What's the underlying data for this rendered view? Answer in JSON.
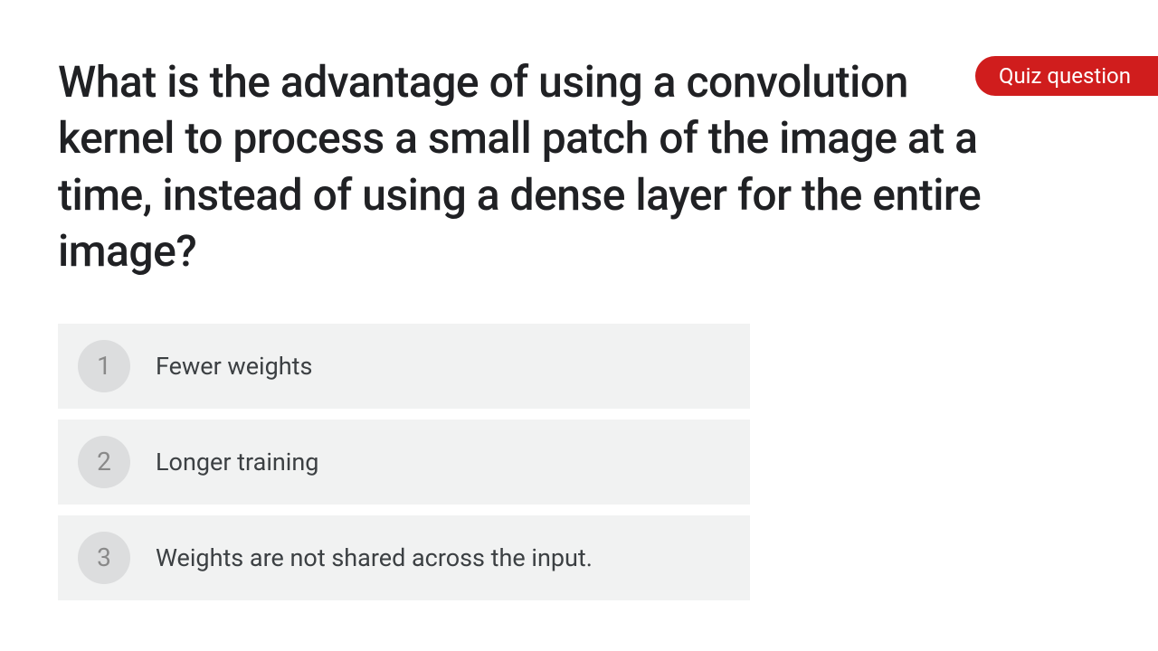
{
  "badge": {
    "label": "Quiz question"
  },
  "question": {
    "text": "What is the advantage of using a convolution kernel to process a small patch of the image at a time, instead of using a dense layer for the entire image?"
  },
  "options": [
    {
      "number": "1",
      "text": "Fewer weights"
    },
    {
      "number": "2",
      "text": "Longer training"
    },
    {
      "number": "3",
      "text": "Weights are not shared across the input."
    }
  ]
}
